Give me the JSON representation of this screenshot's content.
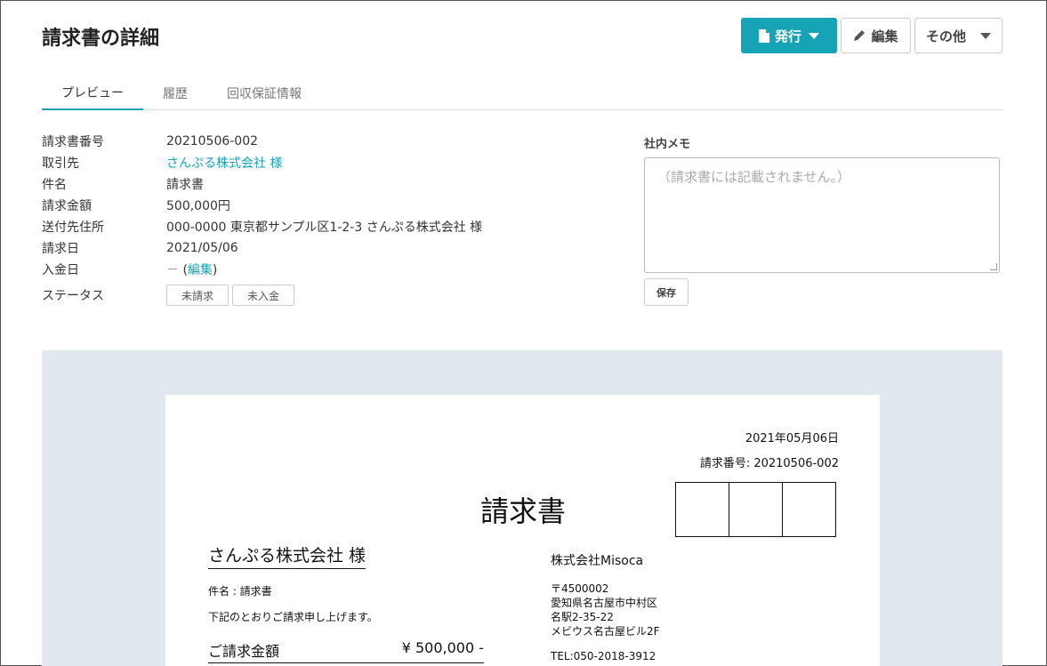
{
  "header": {
    "title": "請求書の詳細",
    "issue_label": "発行",
    "edit_label": "編集",
    "other_label": "その他"
  },
  "tabs": [
    {
      "label": "プレビュー",
      "active": true
    },
    {
      "label": "履歴",
      "active": false
    },
    {
      "label": "回収保証情報",
      "active": false
    }
  ],
  "details": {
    "invoice_number": {
      "label": "請求書番号",
      "value": "20210506-002"
    },
    "client": {
      "label": "取引先",
      "value": "さんぷる株式会社 様"
    },
    "subject": {
      "label": "件名",
      "value": "請求書"
    },
    "amount": {
      "label": "請求金額",
      "value": "500,000円"
    },
    "address": {
      "label": "送付先住所",
      "value": "000-0000 東京都サンプル区1-2-3 さんぷる株式会社 様"
    },
    "invoice_date": {
      "label": "請求日",
      "value": "2021/05/06"
    },
    "payment_date": {
      "label": "入金日",
      "value": "－",
      "edit_link": "編集",
      "open_paren": "(",
      "close_paren": ")"
    },
    "status": {
      "label": "ステータス",
      "tags": [
        "未請求",
        "未入金"
      ]
    }
  },
  "memo": {
    "label": "社内メモ",
    "placeholder": "（請求書には記載されません。）",
    "save_label": "保存"
  },
  "preview": {
    "date": "2021年05月06日",
    "doc_number": "請求番号: 20210506-002",
    "title": "請求書",
    "client": "さんぷる株式会社 様",
    "subject": "件名 : 請求書",
    "greeting": "下記のとおりご請求申し上げます。",
    "amount_label": "ご請求金額",
    "amount_value": "¥ 500,000 -",
    "company": "株式会社Misoca",
    "address_lines": [
      "〒4500002",
      "愛知県名古屋市中村区",
      "名駅2-35-22",
      "メビウス名古屋ビル2F"
    ],
    "tel": "TEL:050-2018-3912"
  },
  "colors": {
    "accent": "#15a3b5",
    "preview_bg": "#e1e8f0"
  },
  "icons": {
    "issue": "document-icon",
    "edit": "pencil-icon"
  }
}
